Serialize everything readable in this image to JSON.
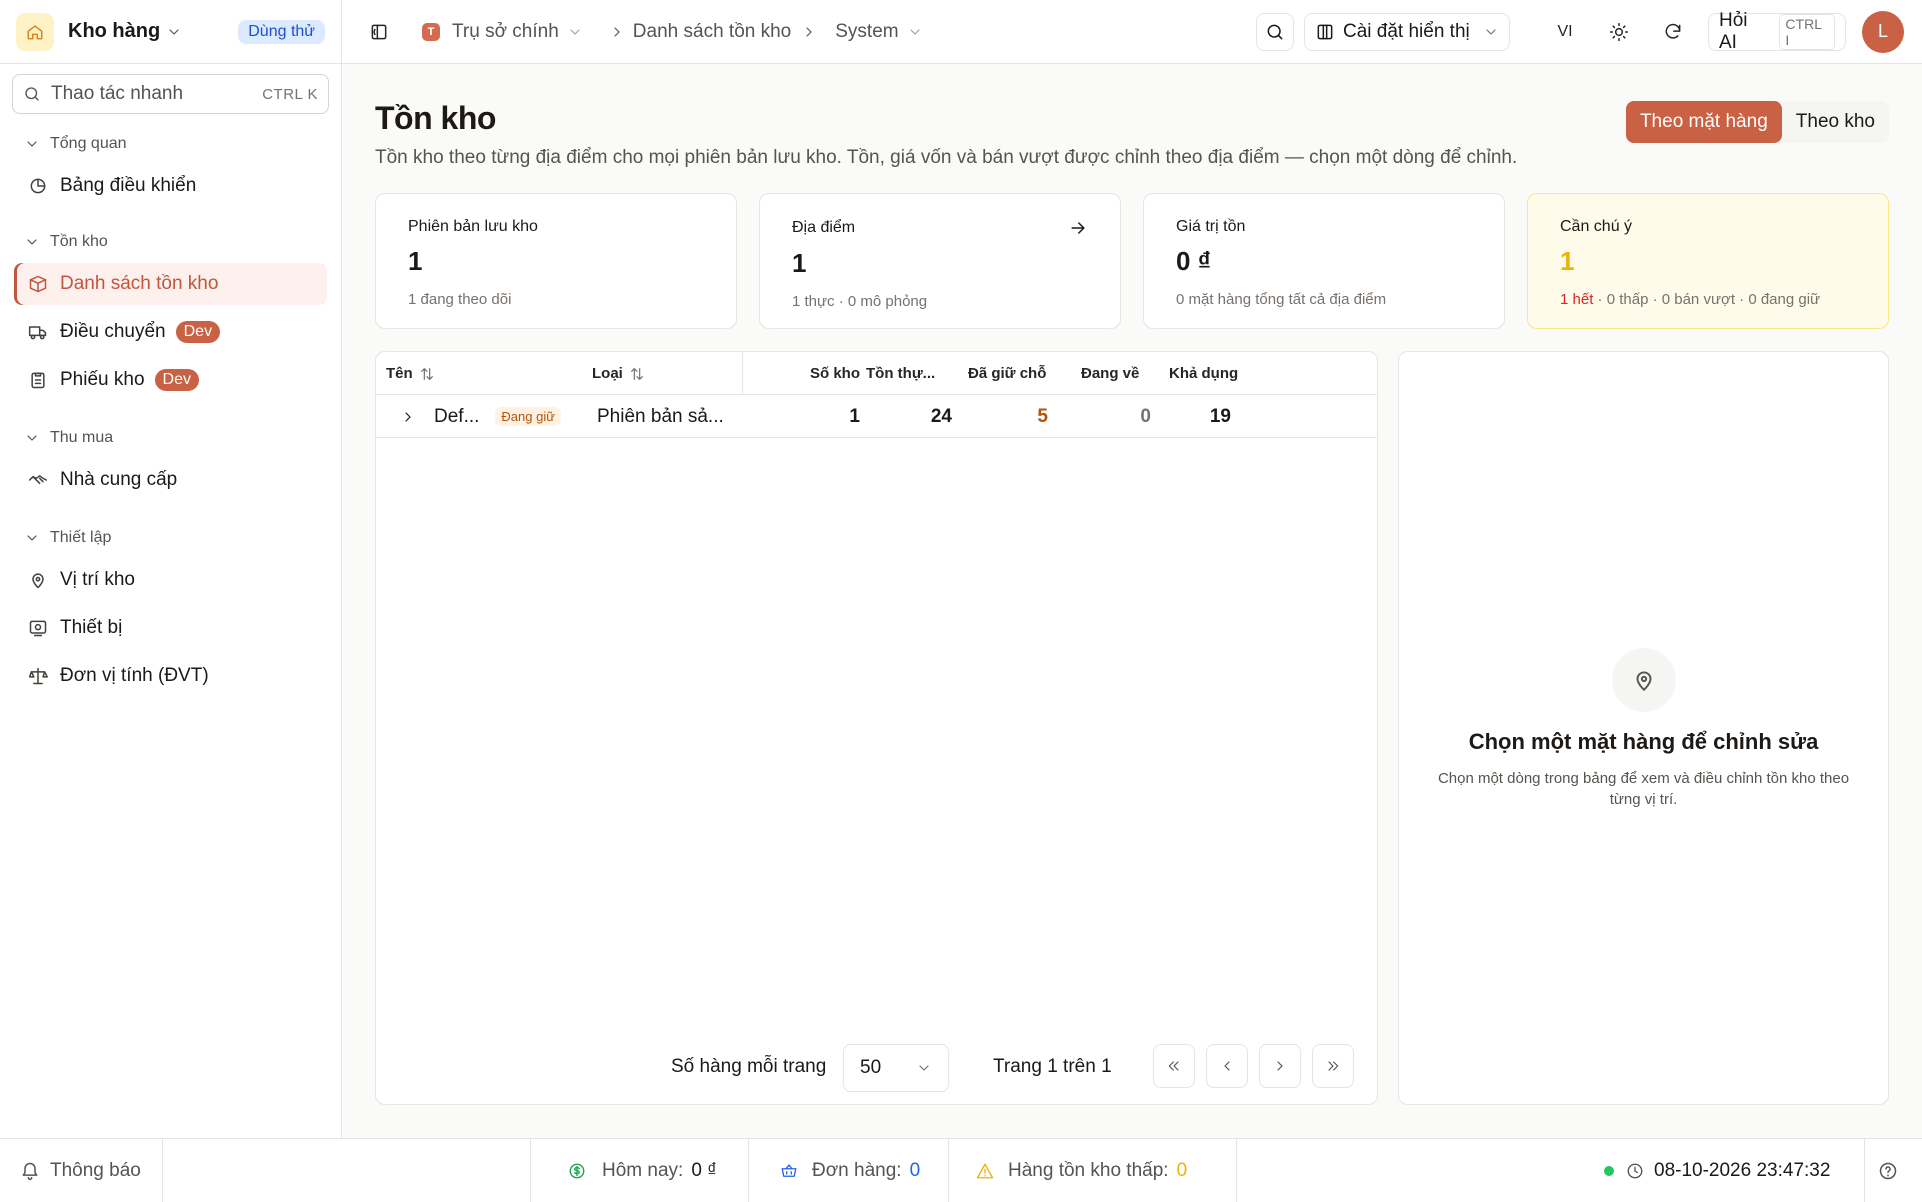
{
  "sidebar": {
    "brand": "Kho hàng",
    "trial_badge": "Dùng thử",
    "search": {
      "label": "Thao tác nhanh",
      "shortcut": "CTRL K"
    },
    "sections": [
      {
        "label": "Tổng quan",
        "items": [
          {
            "label": "Bảng điều khiển",
            "icon": "dashboard-icon"
          }
        ]
      },
      {
        "label": "Tồn kho",
        "items": [
          {
            "label": "Danh sách tồn kho",
            "icon": "box-icon",
            "active": true
          },
          {
            "label": "Điều chuyển",
            "icon": "truck-icon",
            "badge": "Dev"
          },
          {
            "label": "Phiếu kho",
            "icon": "clipboard-icon",
            "badge": "Dev"
          }
        ]
      },
      {
        "label": "Thu mua",
        "items": [
          {
            "label": "Nhà cung cấp",
            "icon": "handshake-icon"
          }
        ]
      },
      {
        "label": "Thiết lập",
        "items": [
          {
            "label": "Vị trí kho",
            "icon": "location-icon"
          },
          {
            "label": "Thiết bị",
            "icon": "device-icon"
          },
          {
            "label": "Đơn vị tính (ĐVT)",
            "icon": "scale-icon"
          }
        ]
      }
    ]
  },
  "header": {
    "org_initial": "T",
    "org": "Trụ sở chính",
    "breadcrumb": "Danh sách tồn kho",
    "context": "System",
    "display_settings": "Cài đặt hiển thị",
    "lang": "VI",
    "ask_ai": "Hỏi AI",
    "ask_ai_shortcut": "CTRL I",
    "avatar_initial": "L"
  },
  "page": {
    "title": "Tồn kho",
    "subtitle": "Tồn kho theo từng địa điểm cho mọi phiên bản lưu kho. Tồn, giá vốn và bán vượt được chỉnh theo địa điểm — chọn một dòng để chỉnh.",
    "view_toggle": {
      "by_item": "Theo mặt hàng",
      "by_warehouse": "Theo kho"
    }
  },
  "stats": {
    "versions": {
      "label": "Phiên bản lưu kho",
      "value": "1",
      "sub": "1 đang theo dõi"
    },
    "locations": {
      "label": "Địa điểm",
      "value": "1",
      "sub": "1 thực · 0 mô phỏng"
    },
    "value": {
      "label": "Giá trị tồn",
      "value": "0 ₫",
      "sub": "0 mặt hàng tổng tất cả địa điểm"
    },
    "attention": {
      "label": "Cần chú ý",
      "value": "1",
      "sub_red": "1 hết",
      "sub_rest": " · 0 thấp · 0 bán vượt · 0 đang giữ"
    }
  },
  "table": {
    "columns": {
      "name": "Tên",
      "type": "Loại",
      "warehouses": "Số kho",
      "on_hand": "Tồn thự...",
      "reserved": "Đã giữ chỗ",
      "incoming": "Đang về",
      "available": "Khả dụng"
    },
    "rows": [
      {
        "name": "Def...",
        "badge": "Đang giữ",
        "type": "Phiên bản sả...",
        "warehouses": "1",
        "on_hand": "24",
        "reserved": "5",
        "incoming": "0",
        "available": "19"
      }
    ],
    "pager": {
      "rows_label": "Số hàng mỗi trang",
      "rows_value": "50",
      "page_info": "Trang 1 trên 1"
    }
  },
  "detail": {
    "title": "Chọn một mặt hàng để chỉnh sửa",
    "subtitle": "Chọn một dòng trong bảng để xem và điều chỉnh tồn kho theo từng vị trí."
  },
  "footer": {
    "notifications": "Thông báo",
    "today_label": "Hôm nay:",
    "today_value": "0 ₫",
    "orders_label": "Đơn hàng:",
    "orders_value": "0",
    "low_stock_label": "Hàng tồn kho thấp:",
    "low_stock_value": "0",
    "datetime": "08-10-2026 23:47:32"
  },
  "colors": {
    "accent": "#c96144",
    "warning_bg": "#fefbeb",
    "status_online": "#22c55e"
  }
}
